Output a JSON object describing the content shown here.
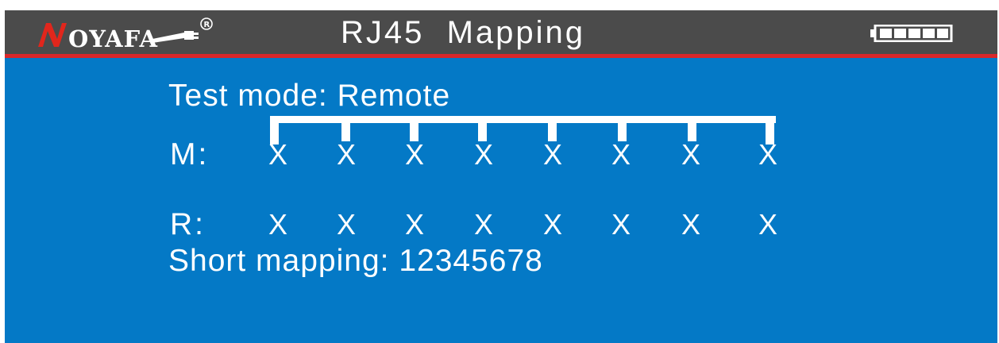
{
  "header": {
    "brand": "OYAFA",
    "brand_initial": "N",
    "registered_mark": "®",
    "title": "RJ45  Mapping",
    "battery_level": 1.0,
    "colors": {
      "bar": "#4b4b4b",
      "accent_rule": "#d9272a",
      "brand_red": "#e1261c"
    }
  },
  "screen": {
    "background": "#0479c6",
    "mode_line": "Test mode: Remote",
    "m_label": "M:",
    "r_label": "R:",
    "m_pins": [
      "X",
      "X",
      "X",
      "X",
      "X",
      "X",
      "X",
      "X"
    ],
    "r_pins": [
      "X",
      "X",
      "X",
      "X",
      "X",
      "X",
      "X",
      "X"
    ],
    "short_line": "Short mapping: 12345678"
  }
}
